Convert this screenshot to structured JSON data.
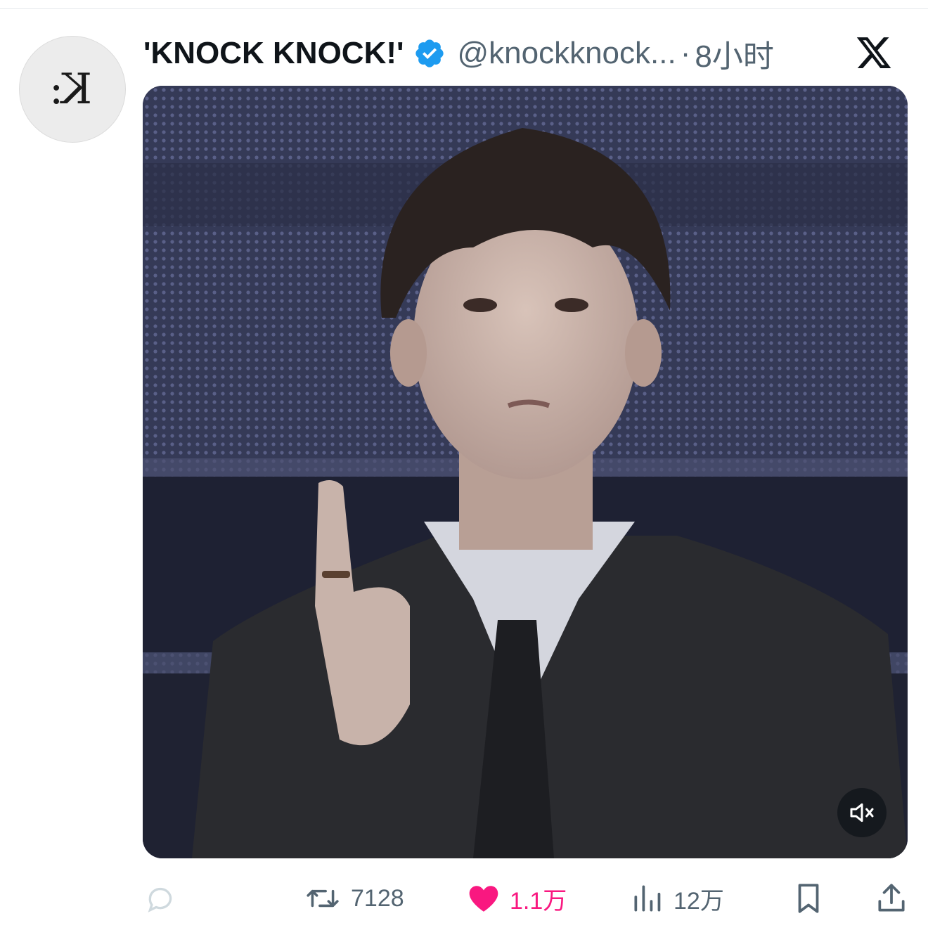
{
  "tweet": {
    "display_name": "'KNOCK KNOCK!'",
    "handle": "@knockknock...",
    "separator": "·",
    "time": "8小时",
    "avatar_icon": "knockknock-logo",
    "verified_icon": "verified-badge-icon",
    "platform_icon": "x-logo-icon"
  },
  "media": {
    "type": "video",
    "mute_icon": "speaker-muted-icon"
  },
  "actions": {
    "reply_count": "",
    "retweet_count": "7128",
    "like_count": "1.1万",
    "view_count": "12万"
  },
  "colors": {
    "verified": "#1d9bf0",
    "like": "#f91880",
    "secondary_text": "#536471",
    "primary_text": "#0f1419"
  }
}
